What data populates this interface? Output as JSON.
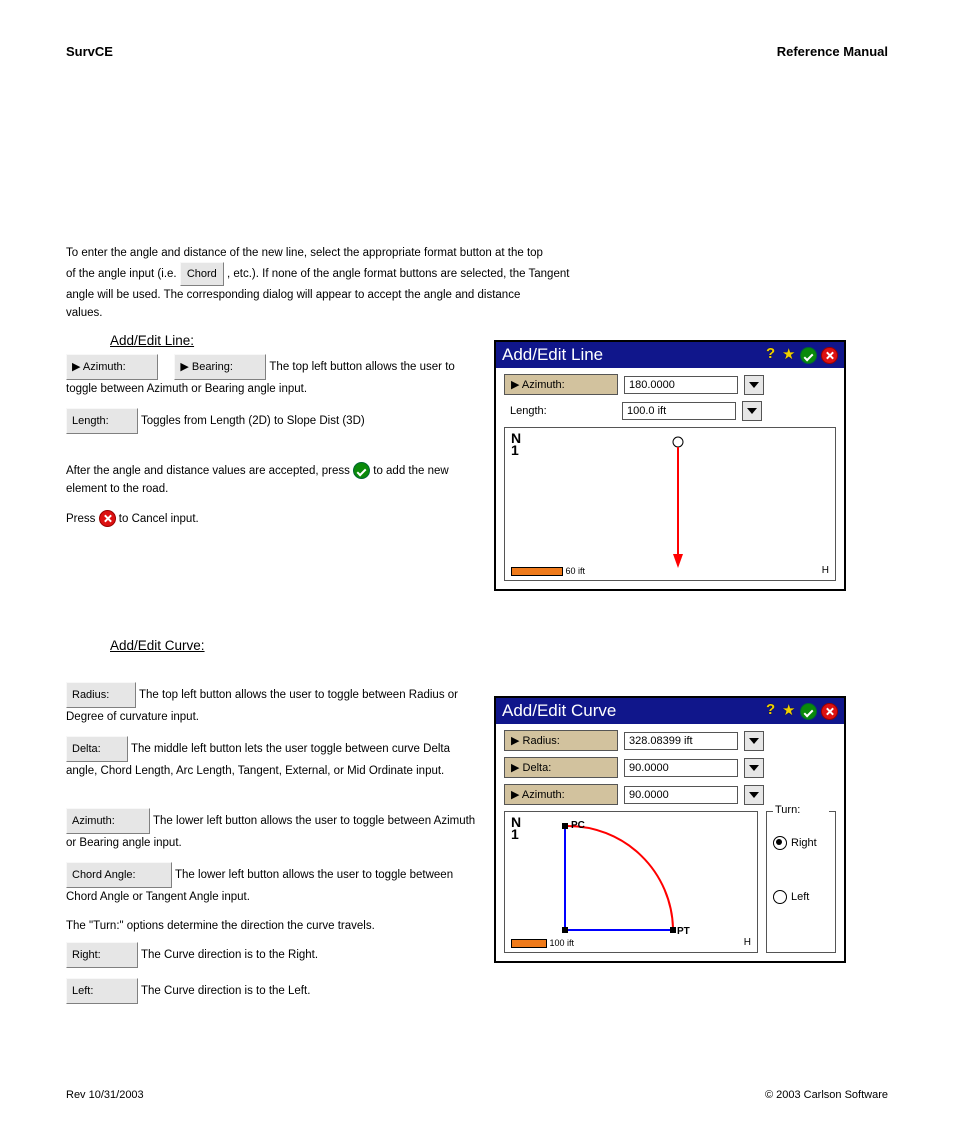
{
  "doc": {
    "title1": "SurvCE",
    "title2": "Reference Manual",
    "para0": "To enter the angle and distance of the new line, select the appropriate format button at the top ",
    "chord": "Chord",
    "para0b": " angle will be used. The corresponding dialog will appear to accept the angle and distance ",
    "para0c": "values.",
    "link1": "Add/Edit Line:",
    "btn_row1_a": "Azimuth:",
    "btn_row1_b": "Bearing:",
    "para1": " The top left button allows the user to toggle between Azimuth or Bearing angle input.",
    "btn_length": "Length:",
    "para2": " Toggles from Length (2D) to Slope Dist (3D)",
    "para3a": "After the angle and distance values are accepted, press ",
    "para3b": " to add the new element to the road.",
    "para4a": "Press ",
    "para4b": " to Cancel input.",
    "link2": "Add/Edit Curve:",
    "btn_radius": "Radius:",
    "desc_radius": " The top left button allows the user to toggle between Radius or Degree of curvature input.",
    "btn_delta": "Delta:",
    "desc_delta": " The middle left button lets the user toggle between curve Delta angle, Chord Length, Arc Length, Tangent, External, or Mid Ordinate input.",
    "btn_azimuth": "Azimuth:",
    "desc_azimuth": " The lower left button allows the user to toggle between Azimuth or Bearing angle input.",
    "btn_chord_ang": "Chord Angle:",
    "desc_chord_ang": " The lower left button allows the user to toggle between Chord Angle or Tangent Angle input.",
    "turn_heading": "The \"Turn:\" options determine the direction the curve travels.",
    "btn_right": "Right:",
    "desc_right": " The Curve direction is to the Right.",
    "btn_left": "Left:",
    "desc_left": " The Curve direction is to the Left.",
    "footer_left": "Rev 10/31/2003",
    "footer_right": "© 2003 Carlson Software"
  },
  "dlg1": {
    "title": "Add/Edit Line",
    "rows": [
      {
        "label": "Azimuth:",
        "value": "180.0000"
      },
      {
        "label": "Length:",
        "value": "100.0 ift",
        "plain": true
      }
    ],
    "scale": "60 ift",
    "h": "H",
    "n": "N",
    "one": "1"
  },
  "dlg2": {
    "title": "Add/Edit Curve",
    "rows": [
      {
        "label": "Radius:",
        "value": "328.08399 ift"
      },
      {
        "label": "Delta:",
        "value": "90.0000"
      },
      {
        "label": "Azimuth:",
        "value": "90.0000"
      }
    ],
    "turn": {
      "label": "Turn:",
      "right": "Right",
      "left": "Left"
    },
    "scale": "100 ift",
    "h": "H",
    "n": "N",
    "one": "1",
    "pc": "PC",
    "pt": "PT"
  }
}
